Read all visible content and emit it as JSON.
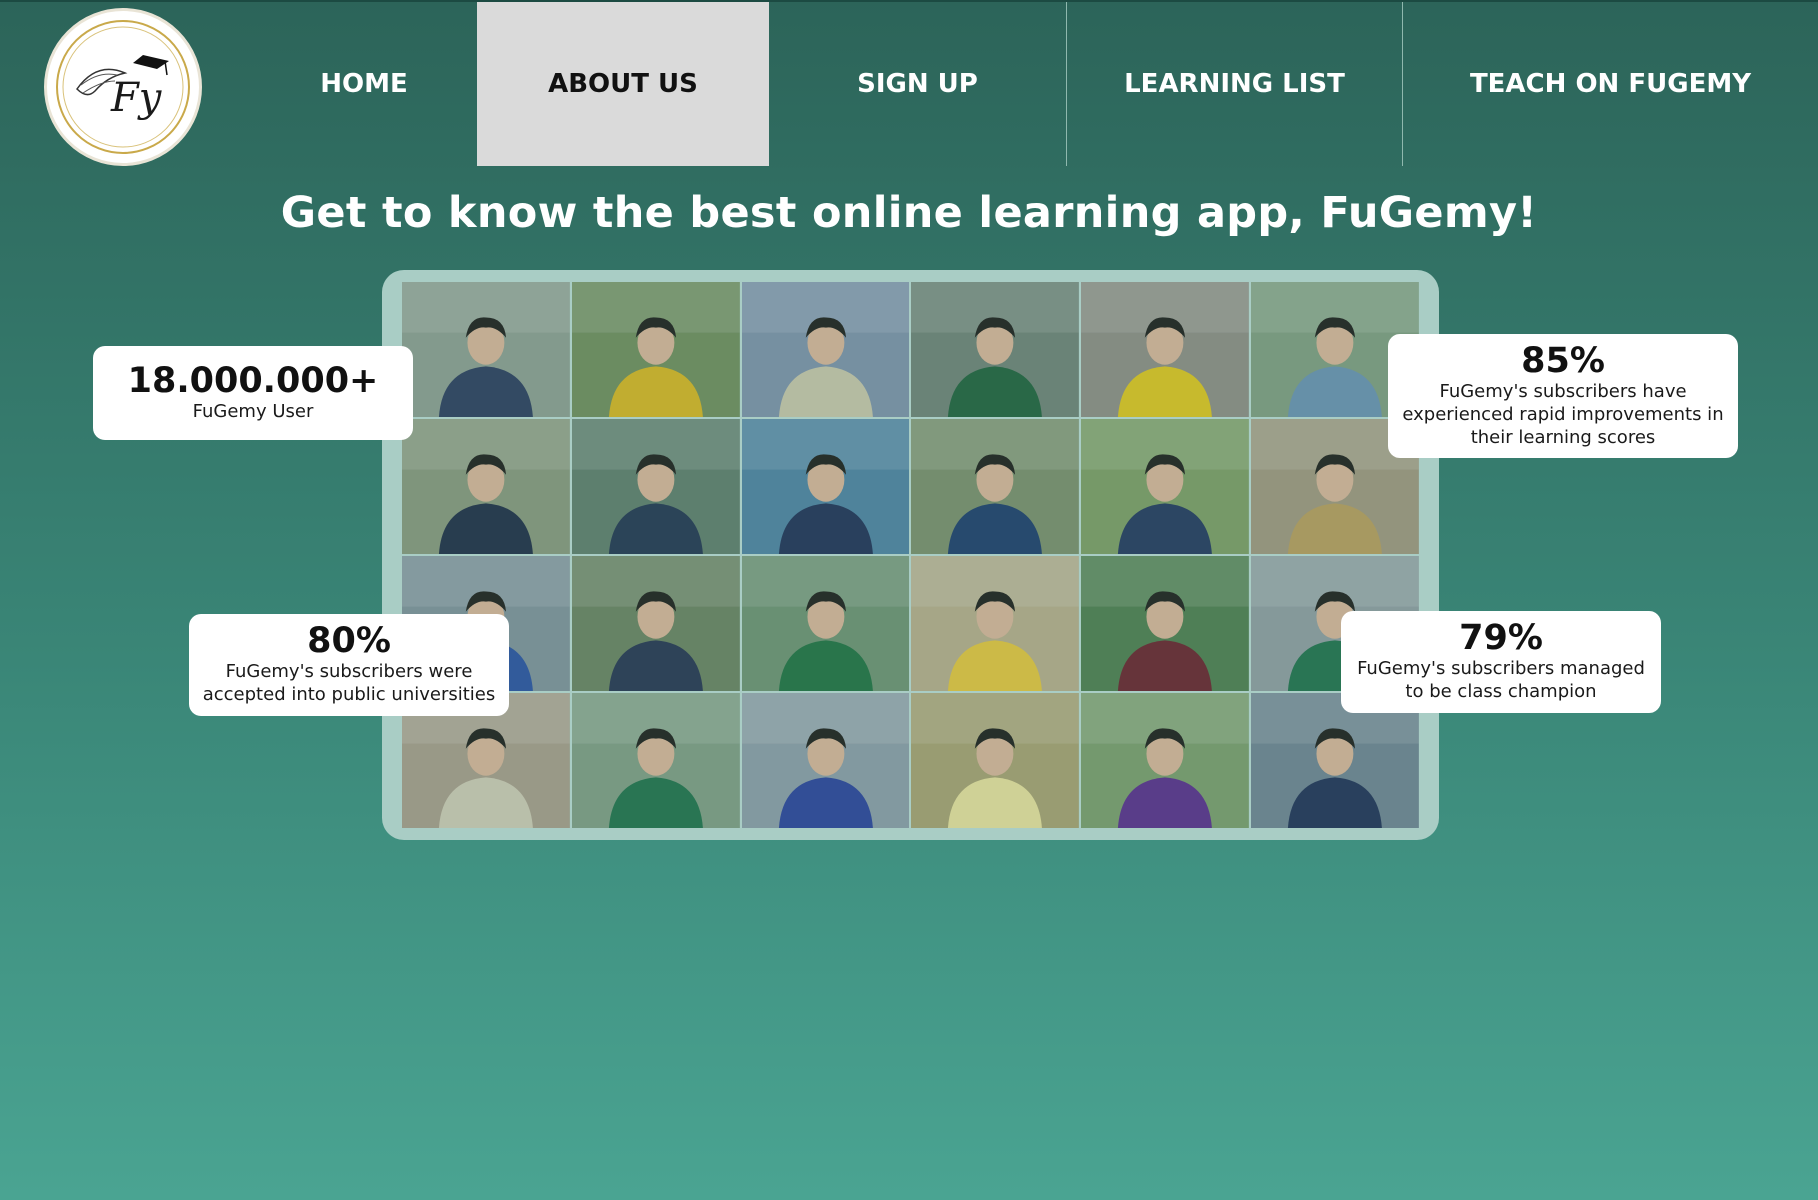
{
  "nav": {
    "items": [
      {
        "label": "HOME"
      },
      {
        "label": "ABOUT US",
        "active": true
      },
      {
        "label": "SIGN UP"
      },
      {
        "label": "LEARNING LIST"
      },
      {
        "label": "TEACH ON FUGEMY"
      }
    ],
    "logo": {
      "icon": "fugemy-logo-icon",
      "text": "Fy"
    }
  },
  "hero": {
    "title": "Get to know the best online learning app, FuGemy!"
  },
  "stats": [
    {
      "value": "18.000.000+",
      "label": "FuGemy User"
    },
    {
      "value": "85%",
      "label": "FuGemy's subscribers have experienced rapid improvements in their learning scores"
    },
    {
      "value": "80%",
      "label": "FuGemy's subscribers were accepted into public universities"
    },
    {
      "value": "79%",
      "label": "FuGemy's subscribers managed to be class champion"
    }
  ],
  "colors": {
    "background_top": "#2c6459",
    "background_bottom": "#4aa492",
    "active_tab": "#dadada",
    "frame": "#a9cdc5"
  }
}
